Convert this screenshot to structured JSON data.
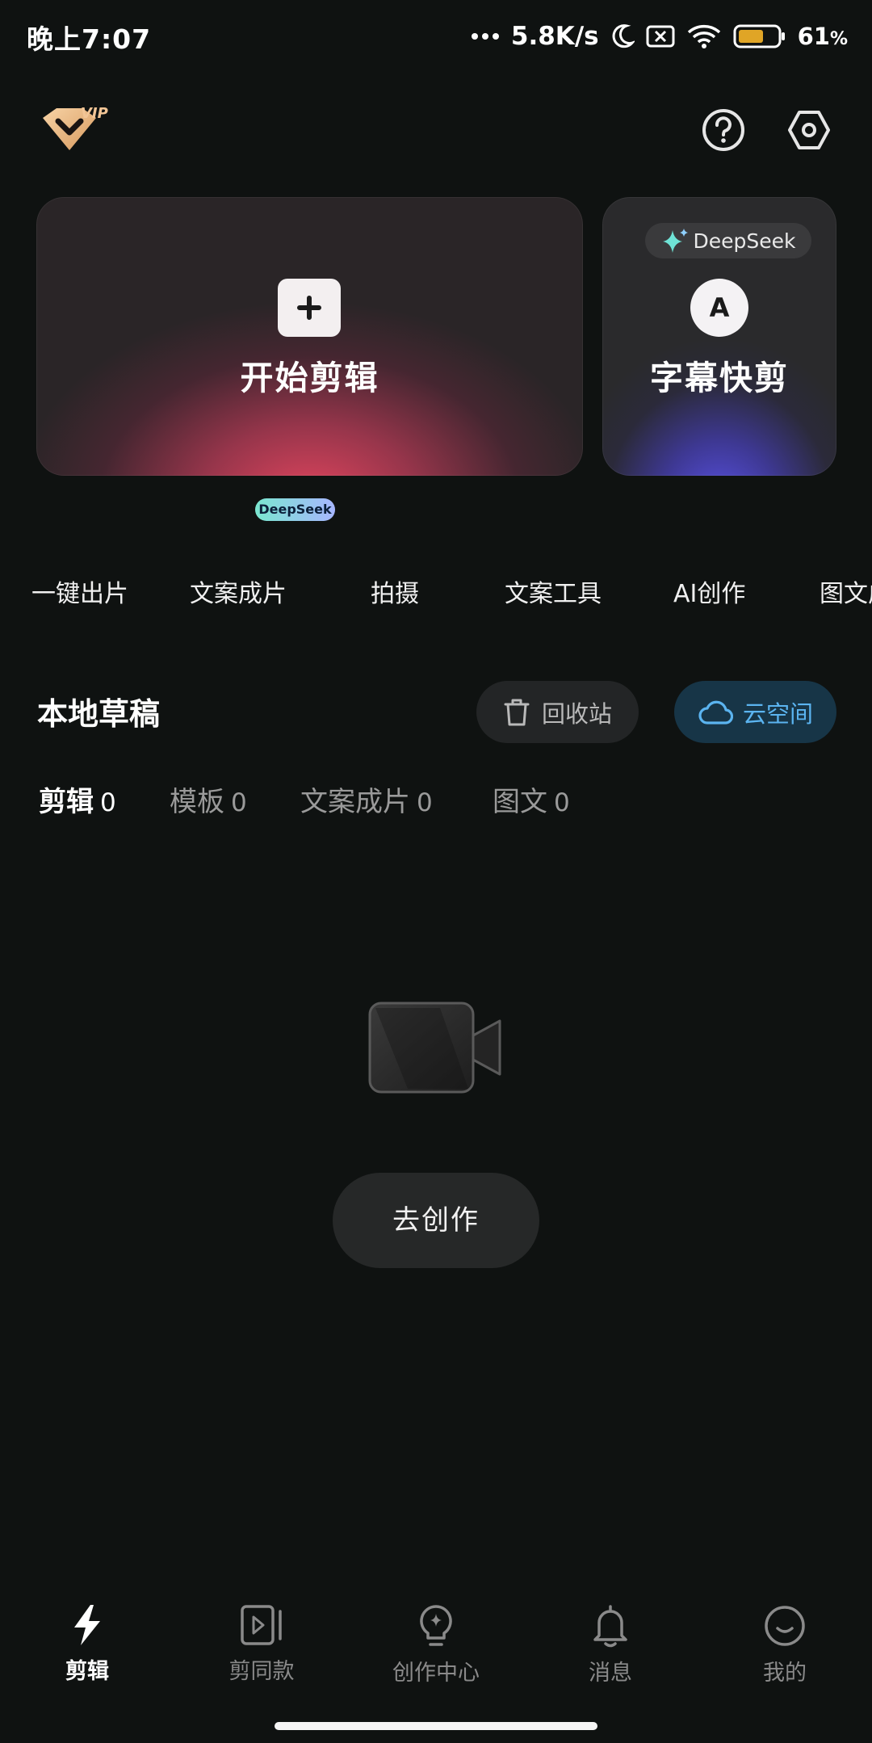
{
  "status_bar": {
    "time": "晚上7:07",
    "net_speed": "5.8K/s",
    "battery": "61",
    "battery_unit": "%"
  },
  "top_bar": {
    "vip_label": "VIP"
  },
  "cards": {
    "start_edit": {
      "title": "开始剪辑"
    },
    "subtitle_cut": {
      "badge": "DeepSeek",
      "icon_letter": "A",
      "title": "字幕快剪"
    }
  },
  "deepseek_badge": "DeepSeek",
  "tools": [
    "一键出片",
    "文案成片",
    "拍摄",
    "文案工具",
    "AI创作",
    "图文成片"
  ],
  "drafts": {
    "title": "本地草稿",
    "recycle_label": "回收站",
    "cloud_label": "云空间",
    "tabs": [
      {
        "label": "剪辑",
        "count": "0"
      },
      {
        "label": "模板",
        "count": "0"
      },
      {
        "label": "文案成片",
        "count": "0"
      },
      {
        "label": "图文",
        "count": "0"
      }
    ],
    "create_label": "去创作"
  },
  "bottom_nav": [
    {
      "label": "剪辑"
    },
    {
      "label": "剪同款"
    },
    {
      "label": "创作中心"
    },
    {
      "label": "消息"
    },
    {
      "label": "我的"
    }
  ],
  "colors": {
    "background": "#0f1211",
    "accent_blue": "#5bb4f0",
    "card_main_glow": "#e84660",
    "card_side_glow": "#5c54f0"
  }
}
